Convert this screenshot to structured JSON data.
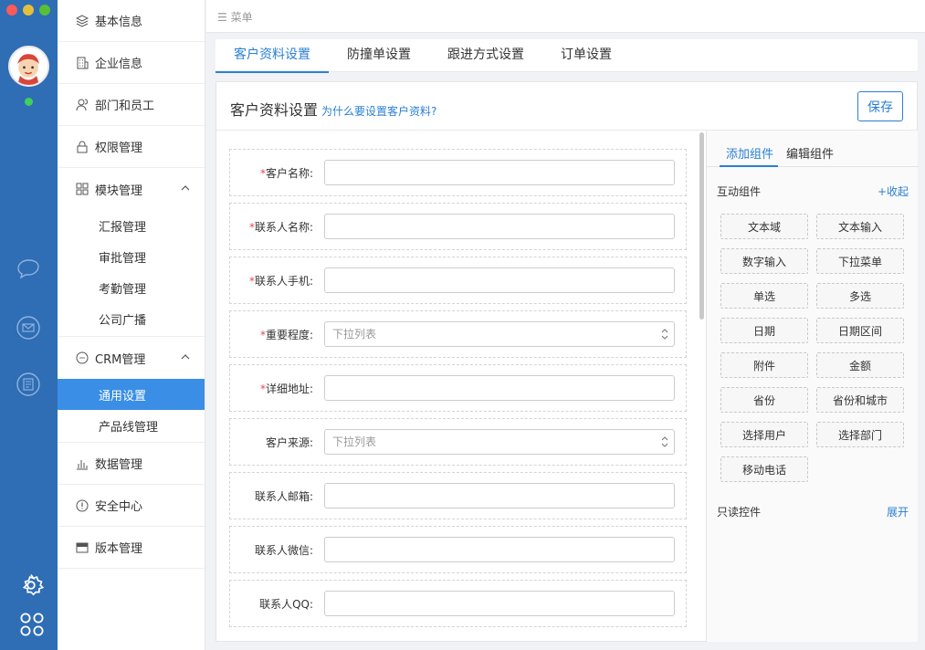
{
  "menu_label": "菜单",
  "nav": {
    "items": [
      {
        "id": "basic",
        "label": "基本信息",
        "icon": "layers-icon"
      },
      {
        "id": "company",
        "label": "企业信息",
        "icon": "building-icon"
      },
      {
        "id": "dept",
        "label": "部门和员工",
        "icon": "users-icon"
      },
      {
        "id": "perm",
        "label": "权限管理",
        "icon": "lock-icon"
      },
      {
        "id": "module",
        "label": "模块管理",
        "icon": "grid-icon"
      }
    ],
    "module_sub": [
      "汇报管理",
      "审批管理",
      "考勤管理",
      "公司广播"
    ],
    "crm": {
      "label": "CRM管理",
      "icon": "crm-icon"
    },
    "crm_sub": [
      "通用设置",
      "产品线管理"
    ],
    "crm_active": "通用设置",
    "bottom_items": [
      {
        "id": "data",
        "label": "数据管理",
        "icon": "bar-chart-icon"
      },
      {
        "id": "security",
        "label": "安全中心",
        "icon": "alert-circle-icon"
      },
      {
        "id": "version",
        "label": "版本管理",
        "icon": "window-icon"
      }
    ]
  },
  "tabs": [
    "客户资料设置",
    "防撞单设置",
    "跟进方式设置",
    "订单设置"
  ],
  "active_tab": "客户资料设置",
  "panel": {
    "title": "客户资料设置",
    "help_link": "为什么要设置客户资料?",
    "save_label": "保存"
  },
  "form_fields": [
    {
      "label": "客户名称:",
      "required": true,
      "type": "text",
      "placeholder": ""
    },
    {
      "label": "联系人名称:",
      "required": true,
      "type": "text",
      "placeholder": ""
    },
    {
      "label": "联系人手机:",
      "required": true,
      "type": "text",
      "placeholder": ""
    },
    {
      "label": "重要程度:",
      "required": true,
      "type": "select",
      "placeholder": "下拉列表"
    },
    {
      "label": "详细地址:",
      "required": true,
      "type": "text",
      "placeholder": ""
    },
    {
      "label": "客户来源:",
      "required": false,
      "type": "select",
      "placeholder": "下拉列表"
    },
    {
      "label": "联系人邮箱:",
      "required": false,
      "type": "text",
      "placeholder": ""
    },
    {
      "label": "联系人微信:",
      "required": false,
      "type": "text",
      "placeholder": ""
    },
    {
      "label": "联系人QQ:",
      "required": false,
      "type": "text",
      "placeholder": ""
    }
  ],
  "components": {
    "tabs": [
      "添加组件",
      "编辑组件"
    ],
    "interactive": {
      "title": "互动组件",
      "toggle": "+收起",
      "chips": [
        "文本域",
        "文本输入",
        "数字输入",
        "下拉菜单",
        "单选",
        "多选",
        "日期",
        "日期区间",
        "附件",
        "金额",
        "省份",
        "省份和城市",
        "选择用户",
        "选择部门",
        "移动电话"
      ]
    },
    "readonly": {
      "title": "只读控件",
      "toggle": "展开"
    }
  },
  "colors": {
    "rail": "#2f6db5",
    "accent": "#2a7fd4",
    "active_nav": "#3a8ee6",
    "required": "#e84a4a"
  }
}
